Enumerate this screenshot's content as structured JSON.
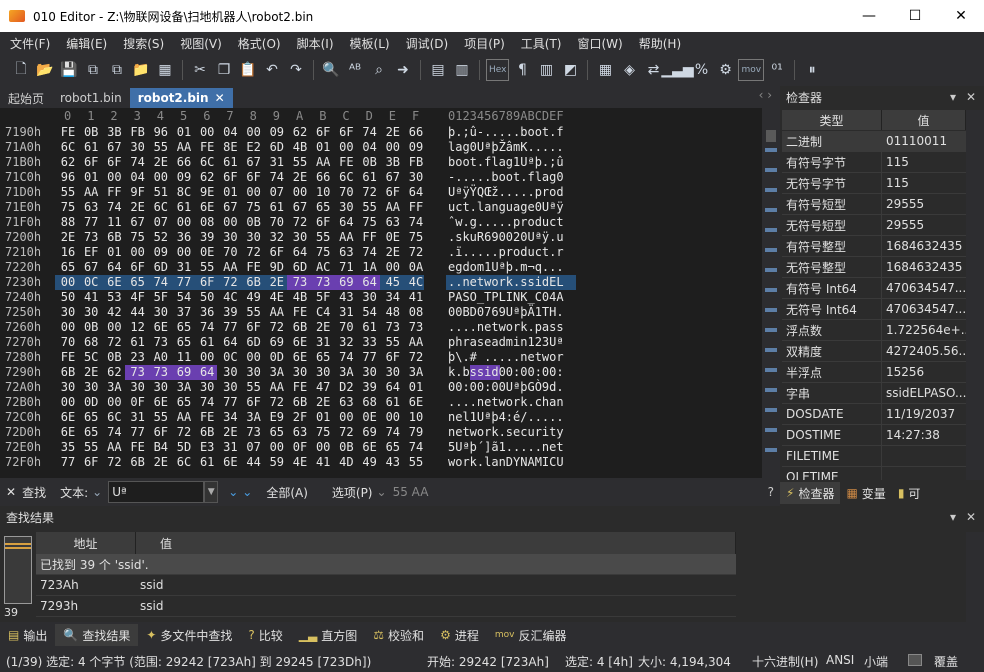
{
  "window": {
    "title": "010 Editor - Z:\\物联网设备\\扫地机器人\\robot2.bin",
    "minimize": "—",
    "maximize": "☐",
    "close": "✕"
  },
  "menu": [
    "文件(F)",
    "编辑(E)",
    "搜索(S)",
    "视图(V)",
    "格式(O)",
    "脚本(I)",
    "模板(L)",
    "调试(D)",
    "项目(P)",
    "工具(T)",
    "窗口(W)",
    "帮助(H)"
  ],
  "toolbar": {
    "hex_label": "Hex",
    "mov_label": "mov"
  },
  "tabs": [
    {
      "label": "起始页",
      "active": false
    },
    {
      "label": "robot1.bin",
      "active": false
    },
    {
      "label": "robot2.bin",
      "active": true,
      "close": "✕"
    }
  ],
  "tab_nav": "‹ ›",
  "editor": {
    "col_header": [
      "0",
      "1",
      "2",
      "3",
      "4",
      "5",
      "6",
      "7",
      "8",
      "9",
      "A",
      "B",
      "C",
      "D",
      "E",
      "F"
    ],
    "text_header": "0123456789ABCDEF",
    "rows": [
      {
        "addr": "7190h",
        "bytes": [
          "FE",
          "0B",
          "3B",
          "FB",
          "96",
          "01",
          "00",
          "04",
          "00",
          "09",
          "62",
          "6F",
          "6F",
          "74",
          "2E",
          "66"
        ],
        "text": "þ.;û-.....boot.f"
      },
      {
        "addr": "71A0h",
        "bytes": [
          "6C",
          "61",
          "67",
          "30",
          "55",
          "AA",
          "FE",
          "8E",
          "E2",
          "6D",
          "4B",
          "01",
          "00",
          "04",
          "00",
          "09"
        ],
        "text": "lag0UªþŽâmK....."
      },
      {
        "addr": "71B0h",
        "bytes": [
          "62",
          "6F",
          "6F",
          "74",
          "2E",
          "66",
          "6C",
          "61",
          "67",
          "31",
          "55",
          "AA",
          "FE",
          "0B",
          "3B",
          "FB"
        ],
        "text": "boot.flag1Uªþ.;û"
      },
      {
        "addr": "71C0h",
        "bytes": [
          "96",
          "01",
          "00",
          "04",
          "00",
          "09",
          "62",
          "6F",
          "6F",
          "74",
          "2E",
          "66",
          "6C",
          "61",
          "67",
          "30"
        ],
        "text": "-.....boot.flag0"
      },
      {
        "addr": "71D0h",
        "bytes": [
          "55",
          "AA",
          "FF",
          "9F",
          "51",
          "8C",
          "9E",
          "01",
          "00",
          "07",
          "00",
          "10",
          "70",
          "72",
          "6F",
          "64"
        ],
        "text": "UªÿŸQŒž.....prod"
      },
      {
        "addr": "71E0h",
        "bytes": [
          "75",
          "63",
          "74",
          "2E",
          "6C",
          "61",
          "6E",
          "67",
          "75",
          "61",
          "67",
          "65",
          "30",
          "55",
          "AA",
          "FF"
        ],
        "text": "uct.language0Uªÿ"
      },
      {
        "addr": "71F0h",
        "bytes": [
          "88",
          "77",
          "11",
          "67",
          "07",
          "00",
          "08",
          "00",
          "0B",
          "70",
          "72",
          "6F",
          "64",
          "75",
          "63",
          "74"
        ],
        "text": "ˆw.g.....product"
      },
      {
        "addr": "7200h",
        "bytes": [
          "2E",
          "73",
          "6B",
          "75",
          "52",
          "36",
          "39",
          "30",
          "30",
          "32",
          "30",
          "55",
          "AA",
          "FF",
          "0E",
          "75"
        ],
        "text": ".skuR690020Uªÿ.u"
      },
      {
        "addr": "7210h",
        "bytes": [
          "16",
          "EF",
          "01",
          "00",
          "09",
          "00",
          "0E",
          "70",
          "72",
          "6F",
          "64",
          "75",
          "63",
          "74",
          "2E",
          "72"
        ],
        "text": ".ï.....product.r"
      },
      {
        "addr": "7220h",
        "bytes": [
          "65",
          "67",
          "64",
          "6F",
          "6D",
          "31",
          "55",
          "AA",
          "FE",
          "9D",
          "6D",
          "AC",
          "71",
          "1A",
          "00",
          "0A"
        ],
        "text": "egdom1Uªþ.m¬q..."
      },
      {
        "addr": "7230h",
        "bytes": [
          "00",
          "0C",
          "6E",
          "65",
          "74",
          "77",
          "6F",
          "72",
          "6B",
          "2E",
          "73",
          "73",
          "69",
          "64",
          "45",
          "4C"
        ],
        "text": "..network.ssidEL"
      },
      {
        "addr": "7240h",
        "bytes": [
          "50",
          "41",
          "53",
          "4F",
          "5F",
          "54",
          "50",
          "4C",
          "49",
          "4E",
          "4B",
          "5F",
          "43",
          "30",
          "34",
          "41"
        ],
        "text": "PASO_TPLINK_C04A"
      },
      {
        "addr": "7250h",
        "bytes": [
          "30",
          "30",
          "42",
          "44",
          "30",
          "37",
          "36",
          "39",
          "55",
          "AA",
          "FE",
          "C4",
          "31",
          "54",
          "48",
          "08"
        ],
        "text": "00BD0769UªþÄ1TH."
      },
      {
        "addr": "7260h",
        "bytes": [
          "00",
          "0B",
          "00",
          "12",
          "6E",
          "65",
          "74",
          "77",
          "6F",
          "72",
          "6B",
          "2E",
          "70",
          "61",
          "73",
          "73"
        ],
        "text": "....network.pass"
      },
      {
        "addr": "7270h",
        "bytes": [
          "70",
          "68",
          "72",
          "61",
          "73",
          "65",
          "61",
          "64",
          "6D",
          "69",
          "6E",
          "31",
          "32",
          "33",
          "55",
          "AA"
        ],
        "text": "phraseadmin123Uª"
      },
      {
        "addr": "7280h",
        "bytes": [
          "FE",
          "5C",
          "0B",
          "23",
          "A0",
          "11",
          "00",
          "0C",
          "00",
          "0D",
          "6E",
          "65",
          "74",
          "77",
          "6F",
          "72"
        ],
        "text": "þ\\.# .....networ"
      },
      {
        "addr": "7290h",
        "bytes": [
          "6B",
          "2E",
          "62",
          "73",
          "73",
          "69",
          "64",
          "30",
          "30",
          "3A",
          "30",
          "30",
          "3A",
          "30",
          "30",
          "3A"
        ],
        "text": "k.bssid00:00:00:"
      },
      {
        "addr": "72A0h",
        "bytes": [
          "30",
          "30",
          "3A",
          "30",
          "30",
          "3A",
          "30",
          "30",
          "55",
          "AA",
          "FE",
          "47",
          "D2",
          "39",
          "64",
          "01"
        ],
        "text": "00:00:00UªþGÒ9d."
      },
      {
        "addr": "72B0h",
        "bytes": [
          "00",
          "0D",
          "00",
          "0F",
          "6E",
          "65",
          "74",
          "77",
          "6F",
          "72",
          "6B",
          "2E",
          "63",
          "68",
          "61",
          "6E"
        ],
        "text": "....network.chan"
      },
      {
        "addr": "72C0h",
        "bytes": [
          "6E",
          "65",
          "6C",
          "31",
          "55",
          "AA",
          "FE",
          "34",
          "3A",
          "E9",
          "2F",
          "01",
          "00",
          "0E",
          "00",
          "10"
        ],
        "text": "nel1Uªþ4:é/....."
      },
      {
        "addr": "72D0h",
        "bytes": [
          "6E",
          "65",
          "74",
          "77",
          "6F",
          "72",
          "6B",
          "2E",
          "73",
          "65",
          "63",
          "75",
          "72",
          "69",
          "74",
          "79"
        ],
        "text": "network.security"
      },
      {
        "addr": "72E0h",
        "bytes": [
          "35",
          "55",
          "AA",
          "FE",
          "B4",
          "5D",
          "E3",
          "31",
          "07",
          "00",
          "0F",
          "00",
          "0B",
          "6E",
          "65",
          "74"
        ],
        "text": "5Uªþ´]ã1.....net"
      },
      {
        "addr": "72F0h",
        "bytes": [
          "77",
          "6F",
          "72",
          "6B",
          "2E",
          "6C",
          "61",
          "6E",
          "44",
          "59",
          "4E",
          "41",
          "4D",
          "49",
          "43",
          "55"
        ],
        "text": "work.lanDYNAMICU"
      }
    ]
  },
  "find": {
    "label": "查找",
    "type_label": "文本:",
    "value": "Uª",
    "all_label": "全部(A)",
    "options_label": "选项(P)",
    "hint": "55 AA"
  },
  "inspector": {
    "title": "检查器",
    "pin": "▾",
    "close": "✕",
    "col_type": "类型",
    "col_value": "值",
    "rows": [
      {
        "k": "二进制",
        "v": "01110011"
      },
      {
        "k": "有符号字节",
        "v": "115"
      },
      {
        "k": "无符号字节",
        "v": "115"
      },
      {
        "k": "有符号短型",
        "v": "29555"
      },
      {
        "k": "无符号短型",
        "v": "29555"
      },
      {
        "k": "有符号整型",
        "v": "1684632435"
      },
      {
        "k": "无符号整型",
        "v": "1684632435"
      },
      {
        "k": "有符号 Int64",
        "v": "470634547..."
      },
      {
        "k": "无符号 Int64",
        "v": "470634547..."
      },
      {
        "k": "浮点数",
        "v": "1.722564e+..."
      },
      {
        "k": "双精度",
        "v": "4272405.56..."
      },
      {
        "k": "半浮点",
        "v": "15256"
      },
      {
        "k": "字串",
        "v": "ssidELPASO..."
      },
      {
        "k": "DOSDATE",
        "v": "11/19/2037"
      },
      {
        "k": "DOSTIME",
        "v": "14:27:38"
      },
      {
        "k": "FILETIME",
        "v": ""
      },
      {
        "k": "OLETIME",
        "v": ""
      }
    ],
    "tabs": [
      "检查器",
      "变量",
      "可"
    ]
  },
  "results": {
    "title": "查找结果",
    "col_addr": "地址",
    "col_value": "值",
    "summary": "已找到 39 个 'ssid'.",
    "rows": [
      {
        "addr": "723Ah",
        "value": "ssid"
      },
      {
        "addr": "7293h",
        "value": "ssid"
      }
    ],
    "count": "39"
  },
  "bottom_tabs": [
    "输出",
    "查找结果",
    "多文件中查找",
    "比较",
    "直方图",
    "校验和",
    "进程",
    "反汇编器"
  ],
  "status": {
    "selection": "(1/39) 选定: 4 个字节 (范围: 29242 [723Ah] 到 29245 [723Dh])",
    "start": "开始: 29242 [723Ah]",
    "sel": "选定: 4 [4h]",
    "size": "大小: 4,194,304",
    "mode": "十六进制(H)",
    "encoding": "ANSI",
    "endian": "小端",
    "overwrite": "覆盖"
  }
}
